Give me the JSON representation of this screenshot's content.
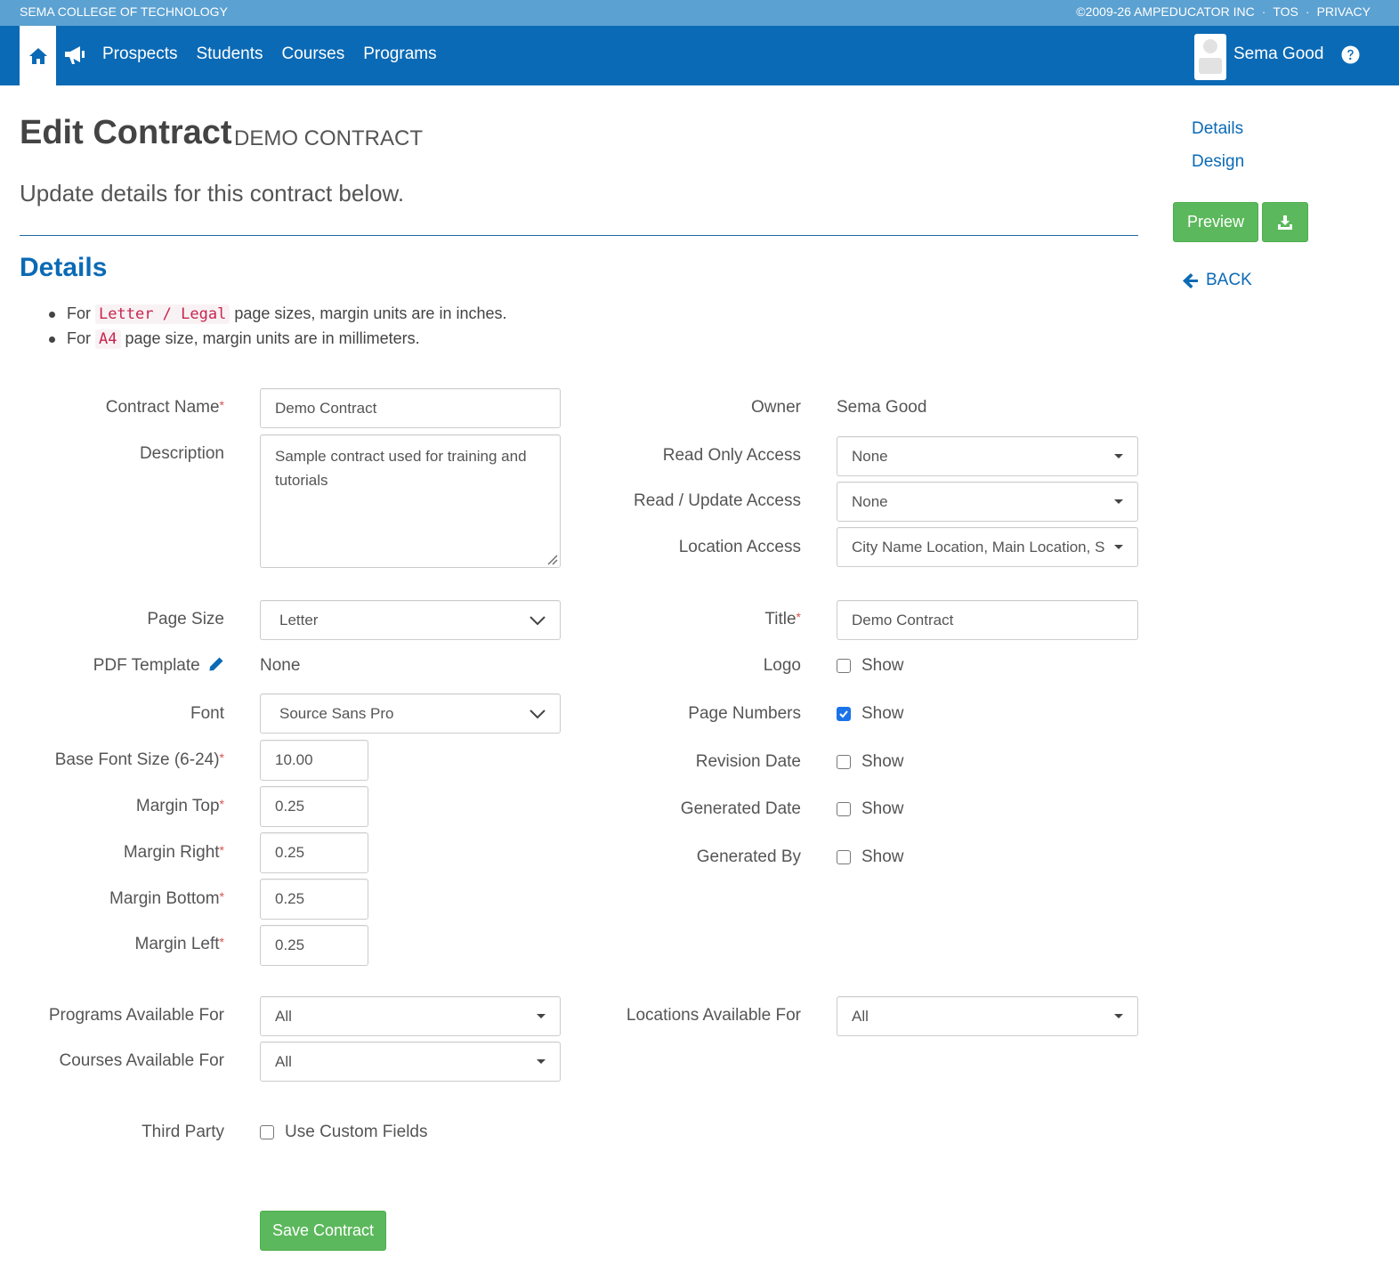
{
  "topbar": {
    "school": "SEMA COLLEGE OF TECHNOLOGY",
    "copyright": "©2009-26 AMPEDUCATOR INC",
    "tos": "TOS",
    "privacy": "PRIVACY",
    "sep": "·"
  },
  "nav": {
    "links": [
      "Prospects",
      "Students",
      "Courses",
      "Programs"
    ],
    "user": "Sema Good"
  },
  "header": {
    "title": "Edit Contract",
    "subtitle": "DEMO CONTRACT",
    "lead": "Update details for this contract below."
  },
  "section": {
    "title": "Details"
  },
  "notes": [
    {
      "pre": "For",
      "code": "Letter / Legal",
      "post": "page sizes, margin units are in inches."
    },
    {
      "pre": "For",
      "code": "A4",
      "post": "page size, margin units are in millimeters."
    }
  ],
  "sidebar": {
    "details": "Details",
    "design": "Design",
    "preview": "Preview",
    "back": "BACK"
  },
  "form": {
    "contract_name": {
      "label": "Contract Name",
      "value": "Demo Contract"
    },
    "description": {
      "label": "Description",
      "value": "Sample contract used for training and tutorials"
    },
    "page_size": {
      "label": "Page Size",
      "value": "Letter"
    },
    "pdf_template": {
      "label": "PDF Template",
      "value": "None"
    },
    "font": {
      "label": "Font",
      "value": "Source Sans Pro"
    },
    "base_font_size": {
      "label": "Base Font Size (6-24)",
      "value": "10.00"
    },
    "margin_top": {
      "label": "Margin Top",
      "value": "0.25"
    },
    "margin_right": {
      "label": "Margin Right",
      "value": "0.25"
    },
    "margin_bottom": {
      "label": "Margin Bottom",
      "value": "0.25"
    },
    "margin_left": {
      "label": "Margin Left",
      "value": "0.25"
    },
    "programs_available": {
      "label": "Programs Available For",
      "value": "All"
    },
    "courses_available": {
      "label": "Courses Available For",
      "value": "All"
    },
    "third_party": {
      "label": "Third Party",
      "option": "Use Custom Fields",
      "checked": false
    },
    "owner": {
      "label": "Owner",
      "value": "Sema Good"
    },
    "read_only_access": {
      "label": "Read Only Access",
      "value": "None"
    },
    "read_update_access": {
      "label": "Read / Update Access",
      "value": "None"
    },
    "location_access": {
      "label": "Location Access",
      "value": "City Name Location, Main Location, S"
    },
    "title": {
      "label": "Title",
      "value": "Demo Contract"
    },
    "logo": {
      "label": "Logo",
      "option": "Show",
      "checked": false
    },
    "page_numbers": {
      "label": "Page Numbers",
      "option": "Show",
      "checked": true
    },
    "revision_date": {
      "label": "Revision Date",
      "option": "Show",
      "checked": false
    },
    "generated_date": {
      "label": "Generated Date",
      "option": "Show",
      "checked": false
    },
    "generated_by": {
      "label": "Generated By",
      "option": "Show",
      "checked": false
    },
    "locations_available": {
      "label": "Locations Available For",
      "value": "All"
    },
    "required_mark": "*",
    "save": "Save Contract"
  },
  "colors": {
    "primary": "#0b6ab5",
    "topbar": "#5ba1d1",
    "success": "#5cb85c",
    "required": "#d9534f"
  }
}
